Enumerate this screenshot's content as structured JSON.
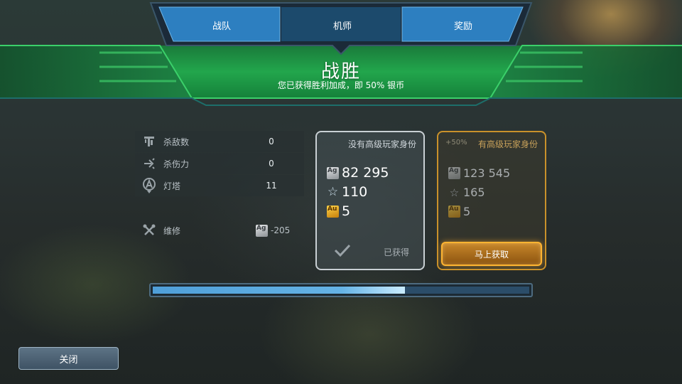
{
  "tabs": [
    {
      "label": "战队"
    },
    {
      "label": "机师"
    },
    {
      "label": "奖励"
    }
  ],
  "header": {
    "title": "战胜",
    "subtitle": "您已获得胜利加成，即 50% 银币"
  },
  "stats": [
    {
      "label": "杀敌数",
      "value": "0",
      "icon": "kills-icon"
    },
    {
      "label": "杀伤力",
      "value": "0",
      "icon": "damage-icon"
    },
    {
      "label": "灯塔",
      "value": "11",
      "icon": "beacon-icon"
    }
  ],
  "repair": {
    "label": "维修",
    "currency": "Ag",
    "cost": "-205"
  },
  "free_card": {
    "title": "没有高级玩家身份",
    "silver": "82 295",
    "stars": "110",
    "gold": "5",
    "status": "已获得"
  },
  "premium_card": {
    "bonus": "+50%",
    "title": "有高级玩家身份",
    "silver": "123 545",
    "stars": "165",
    "gold": "5",
    "button": "马上获取"
  },
  "currency": {
    "silver": "Ag",
    "gold": "Au"
  },
  "progress": {
    "fraction": 0.67
  },
  "footer": {
    "close": "关闭"
  },
  "colors": {
    "banner_green": "#1fa14a",
    "tab_blue": "#2d7fc0",
    "premium_gold": "#c9912a",
    "progress_blue": "#4f9fd9"
  }
}
